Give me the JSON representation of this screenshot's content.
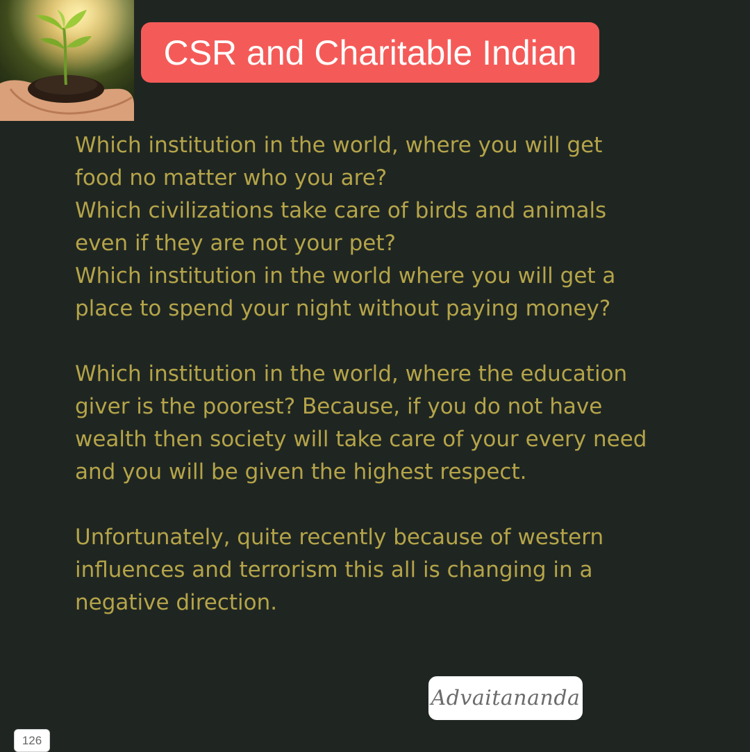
{
  "header": {
    "title": "CSR and Charitable Indian"
  },
  "content": {
    "paragraphs": [
      {
        "lines": [
          "Which institution in the world, where you will get",
          "food no matter who you are?",
          "Which civilizations take care of birds and animals",
          "even if they are not your pet?",
          "Which institution in the world where you will get a",
          "place to spend your night without paying money?"
        ]
      },
      {
        "lines": [
          "Which institution in the world, where the education",
          "giver is the poorest? Because, if you do not have",
          "wealth then society will take care of your every need",
          "and you will be given the highest respect."
        ]
      },
      {
        "lines": [
          "Unfortunately, quite recently because of western",
          "influences and terrorism this all is changing in a",
          "negative direction."
        ]
      }
    ]
  },
  "footer": {
    "signature": "Advaitananda",
    "page_number": "126"
  },
  "colors": {
    "background": "#1f2622",
    "title_background": "#f45b58",
    "title_text": "#ffffff",
    "body_text": "#b5a449",
    "signature_background": "#ffffff"
  },
  "images": {
    "header_photo": "seedling-in-hands-image"
  }
}
